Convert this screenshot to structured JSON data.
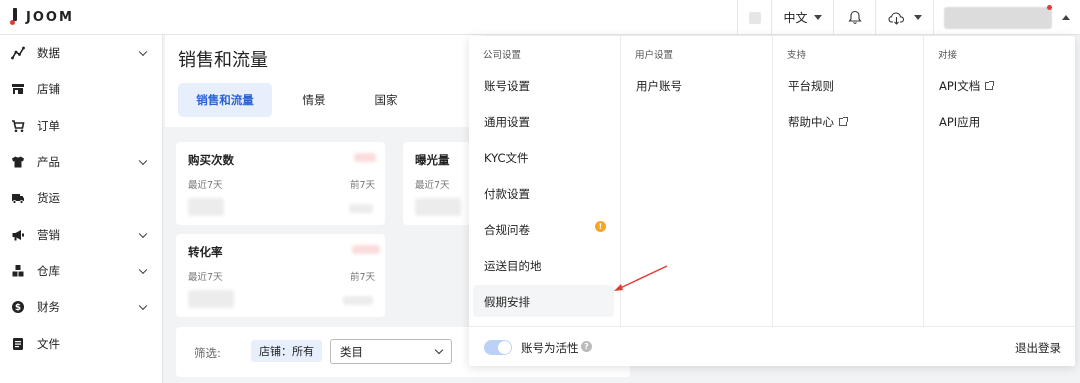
{
  "brand": {
    "name": "JOOM"
  },
  "topbar": {
    "language": "中文"
  },
  "sidebar": {
    "items": [
      {
        "label": "数据",
        "icon": "chart-line-icon",
        "expandable": true
      },
      {
        "label": "店铺",
        "icon": "store-icon",
        "expandable": false
      },
      {
        "label": "订单",
        "icon": "cart-icon",
        "expandable": false
      },
      {
        "label": "产品",
        "icon": "shirt-icon",
        "expandable": true
      },
      {
        "label": "货运",
        "icon": "truck-icon",
        "expandable": false
      },
      {
        "label": "营销",
        "icon": "megaphone-icon",
        "expandable": true
      },
      {
        "label": "仓库",
        "icon": "boxes-icon",
        "expandable": true
      },
      {
        "label": "财务",
        "icon": "dollar-icon",
        "expandable": true
      },
      {
        "label": "文件",
        "icon": "document-icon",
        "expandable": false
      }
    ]
  },
  "main": {
    "title": "销售和流量",
    "tabs": [
      {
        "label": "销售和流量",
        "active": true
      },
      {
        "label": "情景",
        "active": false
      },
      {
        "label": "国家",
        "active": false
      }
    ],
    "cards": [
      {
        "title": "购买次数",
        "sub_left": "最近7天",
        "sub_right": "前7天"
      },
      {
        "title": "曝光量",
        "sub_left": "最近7天"
      },
      {
        "title": "转化率",
        "sub_left": "最近7天",
        "sub_right": "前7天"
      }
    ],
    "filter": {
      "label": "筛选:",
      "chip": "店铺：所有",
      "select": "类目"
    }
  },
  "menu": {
    "columns": [
      {
        "header": "公司设置",
        "items": [
          "账号设置",
          "通用设置",
          "KYC文件",
          "付款设置",
          "合规问卷",
          "运送目的地",
          "假期安排"
        ]
      },
      {
        "header": "用户设置",
        "items": [
          "用户账号"
        ]
      },
      {
        "header": "支持",
        "items": [
          "平台规则",
          "帮助中心"
        ]
      },
      {
        "header": "对接",
        "items": [
          "API文档",
          "API应用"
        ]
      }
    ],
    "warning_badge": "!",
    "footer": {
      "toggle_label": "账号为活性",
      "toggle_on": true,
      "help": "?",
      "logout": "退出登录"
    }
  },
  "colors": {
    "accent": "#2a62d6",
    "accent_bg": "#e7effd",
    "warning": "#f5a623",
    "annotation_arrow": "#e53935"
  }
}
